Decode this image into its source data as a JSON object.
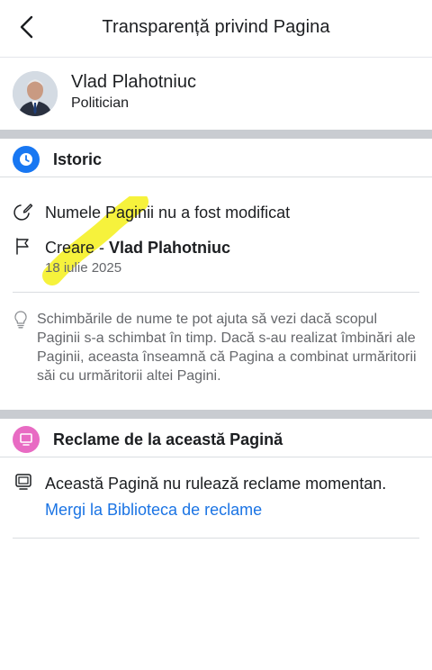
{
  "header": {
    "title": "Transparență privind Pagina"
  },
  "profile": {
    "name": "Vlad Plahotniuc",
    "category": "Politician"
  },
  "history": {
    "title": "Istoric",
    "name_status": "Numele Paginii nu a fost modificat",
    "creation_prefix": "Creare - ",
    "creation_name": "Vlad Plahotniuc",
    "creation_date": "18 iulie 2025",
    "info": "Schimbările de nume te pot ajuta să vezi dacă scopul Paginii s-a schimbat în timp. Dacă s-au realizat îmbinări ale Paginii, aceasta înseamnă că Pagina a combinat urmăritorii săi cu urmăritorii altei Pagini."
  },
  "ads": {
    "title": "Reclame de la această Pagină",
    "status": "Această Pagină nu rulează reclame momentan.",
    "library_link": "Mergi la Biblioteca de reclame"
  },
  "icons": {
    "back": "chevron-left-icon",
    "history": "clock-icon",
    "name_change": "edit-icon",
    "creation": "flag-icon",
    "info": "lightbulb-icon",
    "ads_section": "ad-monitor-icon",
    "ads_row": "monitor-icon"
  },
  "colors": {
    "history_icon_bg": "#1877f2",
    "ads_icon_bg": "#e86bc3",
    "link": "#1b74e4",
    "divider": "#c9ccd1",
    "highlight": "#f5f01a"
  }
}
